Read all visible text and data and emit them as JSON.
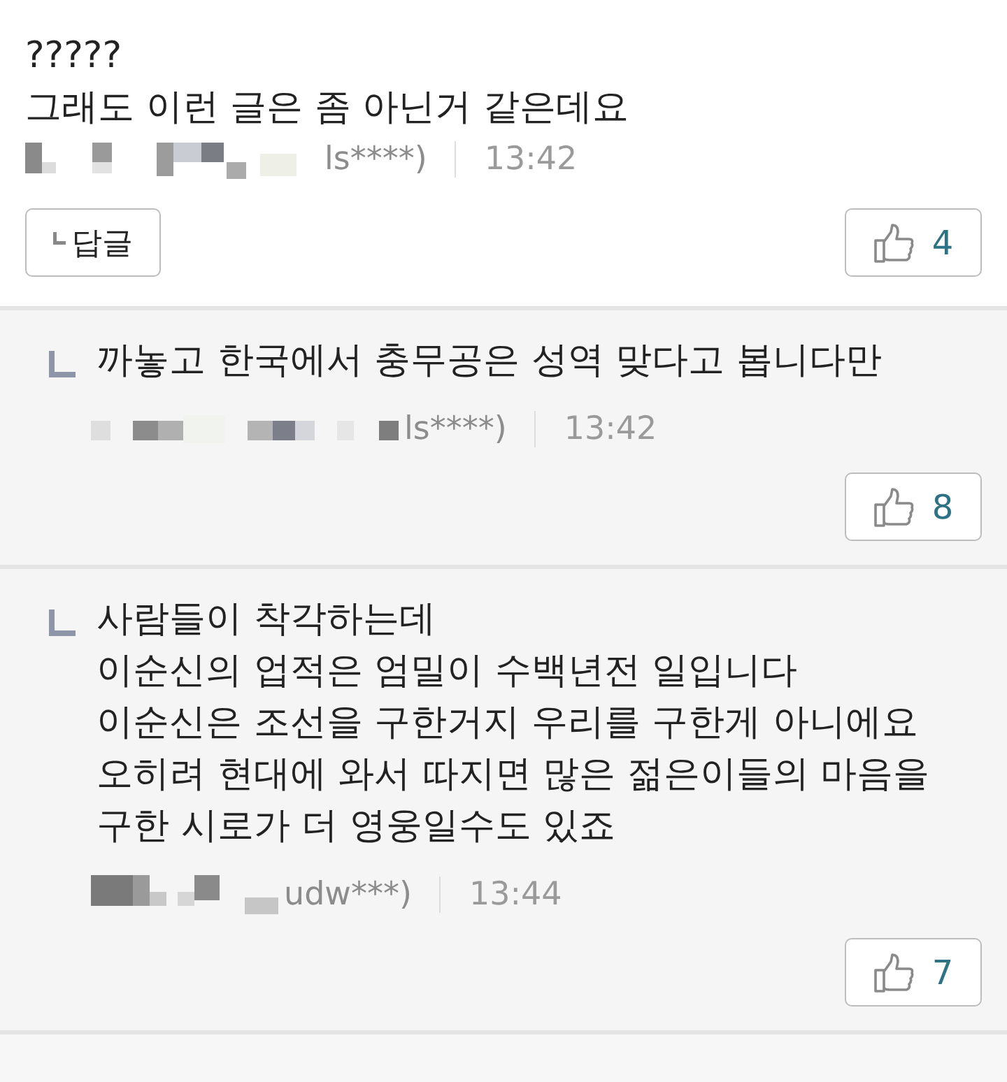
{
  "comments": [
    {
      "kind": "comment",
      "text": "?????\n그래도 이런 글은 좀 아닌거 같은데요",
      "author_masked": true,
      "author": "ls****)",
      "time": "13:42",
      "reply_button": "답글",
      "likes": "4"
    },
    {
      "kind": "reply",
      "text": "까놓고 한국에서 충무공은 성역 맞다고 봅니다만",
      "author_masked": true,
      "author": "ls****)",
      "time": "13:42",
      "likes": "8"
    },
    {
      "kind": "reply",
      "text": "사람들이 착각하는데\n이순신의 업적은 엄밀이 수백년전 일입니다\n이순신은 조선을 구한거지 우리를 구한게 아니에요\n오히려 현대에 와서 따지면 많은 젊은이들의 마음을\n구한 시로가 더 영웅일수도 있죠",
      "author_masked": true,
      "author": "udw***)",
      "time": "13:44",
      "likes": "7"
    }
  ]
}
